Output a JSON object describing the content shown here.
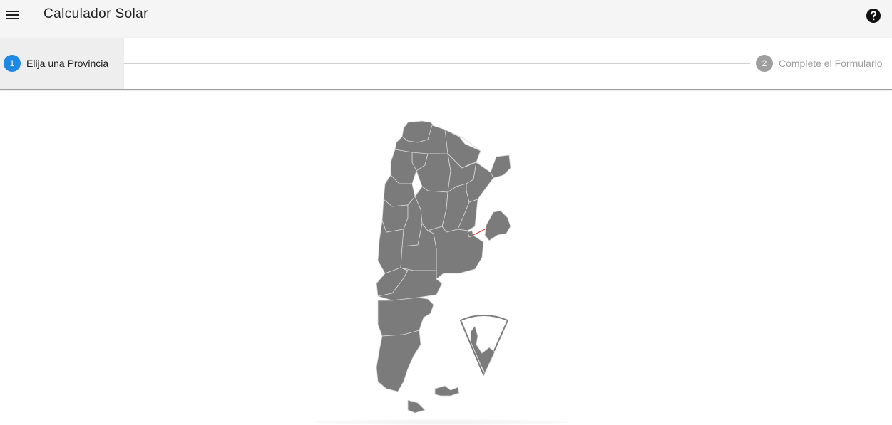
{
  "app": {
    "title": "Calculador Solar",
    "menu_icon": "menu-icon",
    "help_icon": "help-icon"
  },
  "stepper": {
    "steps": [
      {
        "number": "1",
        "label": "Elija una Provincia",
        "state": "active"
      },
      {
        "number": "2",
        "label": "Complete el Formulario",
        "state": "inactive"
      }
    ]
  },
  "map": {
    "icon": "argentina-map",
    "fill_color": "#7b7b7b",
    "border_color": "#d9d9d9",
    "accent_color": "#1e88e5"
  }
}
